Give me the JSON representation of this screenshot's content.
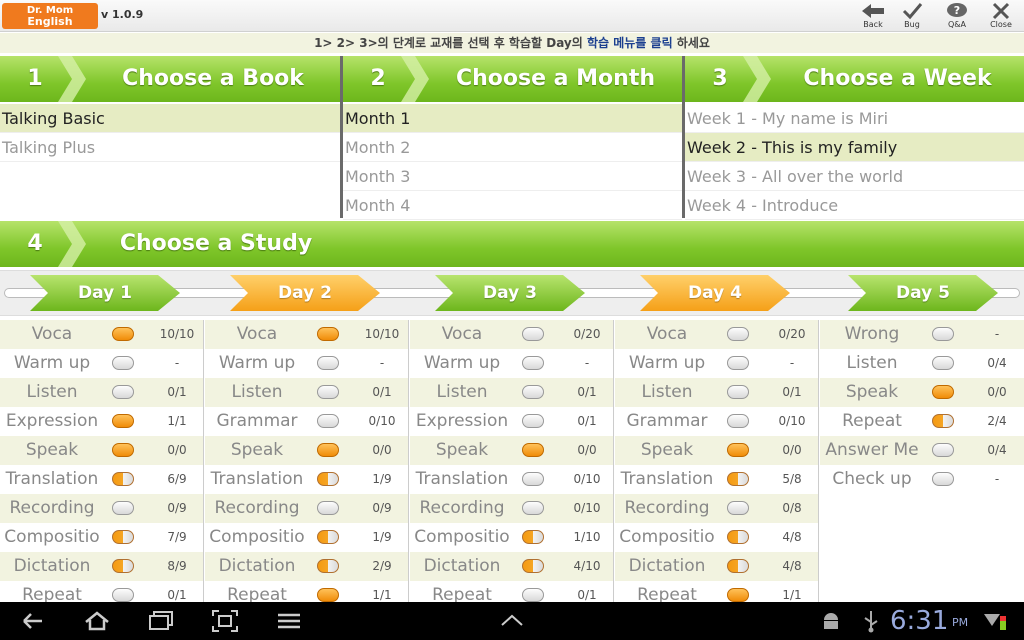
{
  "app": {
    "logo_line1": "Dr. Mom",
    "logo_line2": "English",
    "version": "v 1.0.9",
    "buttons": [
      {
        "label": "Back",
        "icon": "back-arrow-icon"
      },
      {
        "label": "Bug",
        "icon": "checkmark-icon"
      },
      {
        "label": "Q&A",
        "icon": "question-bubble-icon"
      },
      {
        "label": "Close",
        "icon": "close-x-icon"
      }
    ]
  },
  "instruction": {
    "prefix": "1> 2> 3>의 단계로 교재를 선택 후 학습할 Day의 ",
    "highlight": "학습 메뉴를 클릭",
    "suffix": " 하세요"
  },
  "sections": {
    "book": {
      "num": "1",
      "title": "Choose a Book",
      "items": [
        {
          "label": "Talking Basic",
          "selected": true
        },
        {
          "label": "Talking Plus",
          "selected": false
        }
      ]
    },
    "month": {
      "num": "2",
      "title": "Choose a Month",
      "items": [
        {
          "label": "Month 1",
          "selected": true
        },
        {
          "label": "Month 2",
          "selected": false
        },
        {
          "label": "Month 3",
          "selected": false
        },
        {
          "label": "Month 4",
          "selected": false
        }
      ]
    },
    "week": {
      "num": "3",
      "title": "Choose a Week",
      "items": [
        {
          "label": "Week 1 - My name is Miri",
          "selected": false
        },
        {
          "label": "Week 2 - This is my family",
          "selected": true
        },
        {
          "label": "Week 3 - All over the world",
          "selected": false
        },
        {
          "label": "Week 4 - Introduce",
          "selected": false
        }
      ]
    },
    "study": {
      "num": "4",
      "title": "Choose a Study"
    }
  },
  "colors": {
    "green": "#7fc62a",
    "orange": "#f7a823",
    "selected_row": "#e6ecc3"
  },
  "days": [
    {
      "label": "Day 1",
      "color": "green",
      "items": [
        {
          "name": "Voca",
          "status": "full",
          "score": "10/10"
        },
        {
          "name": "Warm up",
          "status": "empty",
          "score": "-"
        },
        {
          "name": "Listen",
          "status": "empty",
          "score": "0/1"
        },
        {
          "name": "Expression",
          "status": "full",
          "score": "1/1"
        },
        {
          "name": "Speak",
          "status": "full",
          "score": "0/0"
        },
        {
          "name": "Translation",
          "status": "half",
          "score": "6/9"
        },
        {
          "name": "Recording",
          "status": "empty",
          "score": "0/9"
        },
        {
          "name": "Compositio",
          "status": "half",
          "score": "7/9"
        },
        {
          "name": "Dictation",
          "status": "half",
          "score": "8/9"
        },
        {
          "name": "Repeat",
          "status": "empty",
          "score": "0/1"
        }
      ]
    },
    {
      "label": "Day 2",
      "color": "orange",
      "items": [
        {
          "name": "Voca",
          "status": "full",
          "score": "10/10"
        },
        {
          "name": "Warm up",
          "status": "empty",
          "score": "-"
        },
        {
          "name": "Listen",
          "status": "empty",
          "score": "0/1"
        },
        {
          "name": "Grammar",
          "status": "empty",
          "score": "0/10"
        },
        {
          "name": "Speak",
          "status": "full",
          "score": "0/0"
        },
        {
          "name": "Translation",
          "status": "half",
          "score": "1/9"
        },
        {
          "name": "Recording",
          "status": "empty",
          "score": "0/9"
        },
        {
          "name": "Compositio",
          "status": "half",
          "score": "1/9"
        },
        {
          "name": "Dictation",
          "status": "half",
          "score": "2/9"
        },
        {
          "name": "Repeat",
          "status": "full",
          "score": "1/1"
        }
      ]
    },
    {
      "label": "Day 3",
      "color": "green",
      "items": [
        {
          "name": "Voca",
          "status": "empty",
          "score": "0/20"
        },
        {
          "name": "Warm up",
          "status": "empty",
          "score": "-"
        },
        {
          "name": "Listen",
          "status": "empty",
          "score": "0/1"
        },
        {
          "name": "Expression",
          "status": "empty",
          "score": "0/1"
        },
        {
          "name": "Speak",
          "status": "full",
          "score": "0/0"
        },
        {
          "name": "Translation",
          "status": "empty",
          "score": "0/10"
        },
        {
          "name": "Recording",
          "status": "empty",
          "score": "0/10"
        },
        {
          "name": "Compositio",
          "status": "half",
          "score": "1/10"
        },
        {
          "name": "Dictation",
          "status": "half",
          "score": "4/10"
        },
        {
          "name": "Repeat",
          "status": "empty",
          "score": "0/1"
        }
      ]
    },
    {
      "label": "Day 4",
      "color": "orange",
      "items": [
        {
          "name": "Voca",
          "status": "empty",
          "score": "0/20"
        },
        {
          "name": "Warm up",
          "status": "empty",
          "score": "-"
        },
        {
          "name": "Listen",
          "status": "empty",
          "score": "0/1"
        },
        {
          "name": "Grammar",
          "status": "empty",
          "score": "0/10"
        },
        {
          "name": "Speak",
          "status": "full",
          "score": "0/0"
        },
        {
          "name": "Translation",
          "status": "half",
          "score": "5/8"
        },
        {
          "name": "Recording",
          "status": "empty",
          "score": "0/8"
        },
        {
          "name": "Compositio",
          "status": "half",
          "score": "4/8"
        },
        {
          "name": "Dictation",
          "status": "half",
          "score": "4/8"
        },
        {
          "name": "Repeat",
          "status": "full",
          "score": "1/1"
        }
      ]
    },
    {
      "label": "Day 5",
      "color": "green",
      "items": [
        {
          "name": "Wrong",
          "status": "empty",
          "score": "-"
        },
        {
          "name": "Listen",
          "status": "empty",
          "score": "0/4"
        },
        {
          "name": "Speak",
          "status": "full",
          "score": "0/0"
        },
        {
          "name": "Repeat",
          "status": "half",
          "score": "2/4"
        },
        {
          "name": "Answer Me",
          "status": "empty",
          "score": "0/4"
        },
        {
          "name": "Check up",
          "status": "empty",
          "score": "-"
        }
      ]
    }
  ],
  "statusbar": {
    "time": "6:31",
    "ampm": "PM"
  }
}
